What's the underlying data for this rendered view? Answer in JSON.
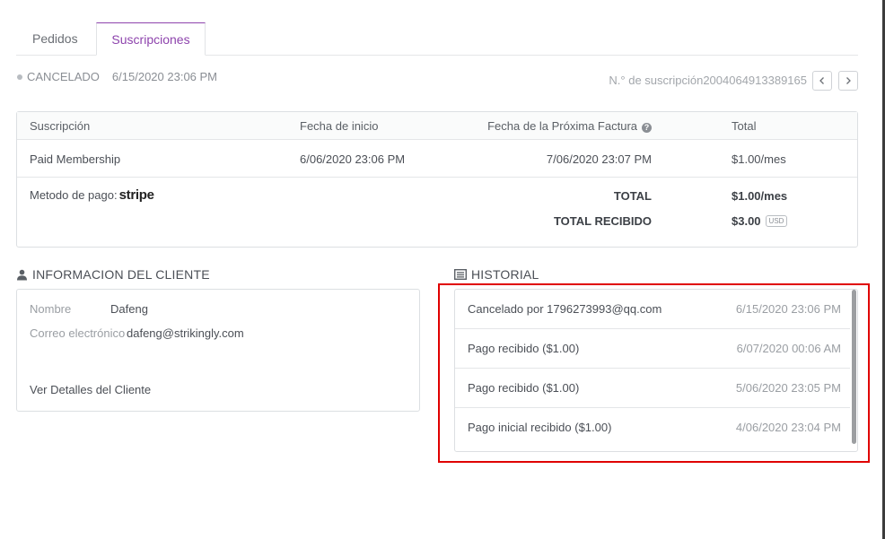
{
  "tabs": [
    {
      "label": "Pedidos"
    },
    {
      "label": "Suscripciones"
    }
  ],
  "status": {
    "label": "CANCELADO",
    "date": "6/15/2020 23:06 PM"
  },
  "subscription_number": "N.° de suscripción2004064913389165",
  "table": {
    "headers": {
      "subscription": "Suscripción",
      "start_date": "Fecha de inicio",
      "next_invoice": "Fecha de la Próxima Factura",
      "total": "Total"
    },
    "row": {
      "subscription": "Paid Membership",
      "start_date": "6/06/2020 23:06 PM",
      "next_invoice": "7/06/2020 23:07 PM",
      "total": "$1.00/mes"
    },
    "payment_label": "Metodo de pago:",
    "payment_method": "stripe",
    "total_label": "TOTAL",
    "total_value": "$1.00/mes",
    "received_label": "TOTAL RECIBIDO",
    "received_value": "$3.00",
    "currency": "USD"
  },
  "client": {
    "section_title": "INFORMACION DEL CLIENTE",
    "name_label": "Nombre",
    "name_value": "Dafeng",
    "email_label": "Correo electrónico",
    "email_value": "dafeng@strikingly.com",
    "details_link": "Ver Detalles del Cliente"
  },
  "history": {
    "section_title": "HISTORIAL",
    "items": [
      {
        "event": "Cancelado por 1796273993@qq.com",
        "time": "6/15/2020 23:06 PM"
      },
      {
        "event": "Pago recibido ($1.00)",
        "time": "6/07/2020 00:06 AM"
      },
      {
        "event": "Pago recibido ($1.00)",
        "time": "5/06/2020 23:05 PM"
      },
      {
        "event": "Pago inicial recibido ($1.00)",
        "time": "4/06/2020 23:04 PM"
      }
    ]
  },
  "colors": {
    "accent": "#8e44ad",
    "link": "#3aa0d8",
    "highlight": "#e00000"
  }
}
